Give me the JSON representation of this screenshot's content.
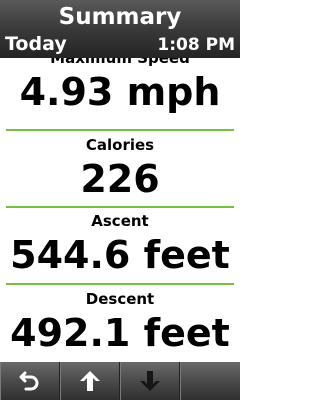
{
  "header": {
    "title": "Summary",
    "date_label": "Today",
    "time": "1:08 PM"
  },
  "fields": [
    {
      "label": "Maximum Speed",
      "value": "4.93 mph"
    },
    {
      "label": "Calories",
      "value": "226"
    },
    {
      "label": "Ascent",
      "value": "544.6 feet"
    },
    {
      "label": "Descent",
      "value": "492.1 feet"
    }
  ],
  "bottom_bar": {
    "buttons": [
      "back-icon",
      "arrow-up-icon",
      "arrow-down-icon"
    ]
  },
  "colors": {
    "header_bg": "#3c3c3c",
    "divider": "#76c043",
    "bottom_bar_bg": "#4a4a4a"
  }
}
